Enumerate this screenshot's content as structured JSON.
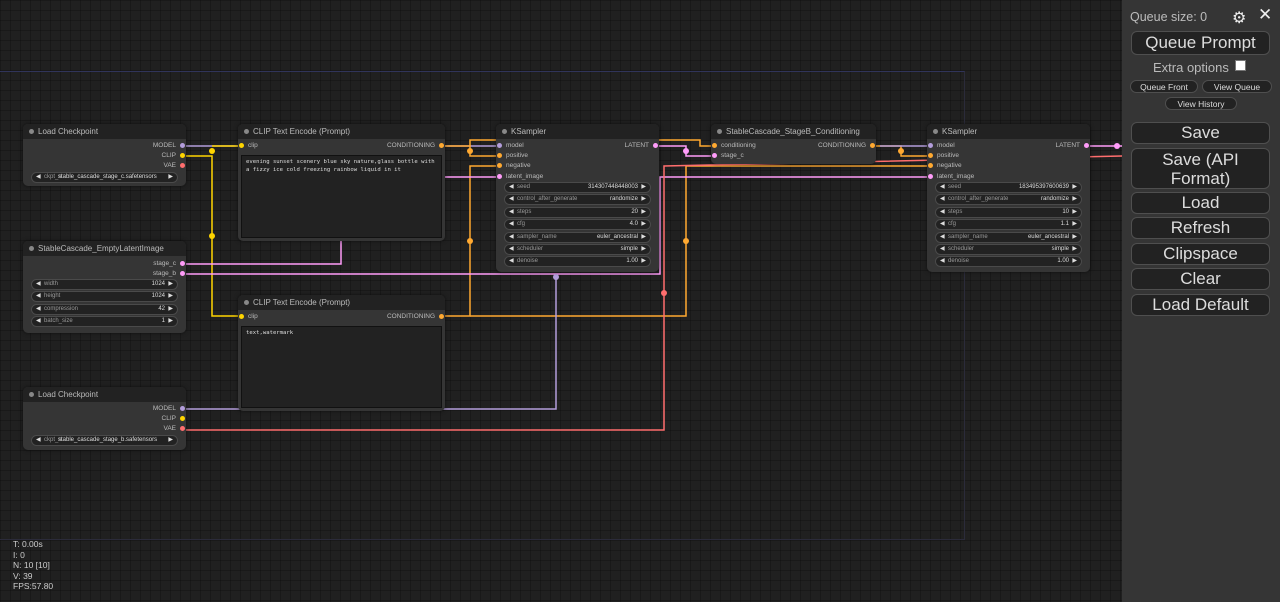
{
  "nodes": {
    "ckpt_c": {
      "title": "Load Checkpoint",
      "outputs": [
        "MODEL",
        "CLIP",
        "VAE"
      ],
      "widget_label": "ckpt_n",
      "widget_value": "stable_cascade_stage_c.safetensors"
    },
    "clip_pos": {
      "title": "CLIP Text Encode (Prompt)",
      "input": "clip",
      "output": "CONDITIONING",
      "text": "evening sunset scenery blue sky nature,glass bottle with a fizzy ice cold freezing rainbow liquid in it"
    },
    "ksampler_c": {
      "title": "KSampler",
      "inputs": [
        "model",
        "positive",
        "negative",
        "latent_image"
      ],
      "output": "LATENT",
      "widgets": [
        {
          "label": "seed",
          "value": "314307448448003"
        },
        {
          "label": "control_after_generate",
          "value": "randomize"
        },
        {
          "label": "steps",
          "value": "20"
        },
        {
          "label": "cfg",
          "value": "4.0"
        },
        {
          "label": "sampler_name",
          "value": "euler_ancestral"
        },
        {
          "label": "scheduler",
          "value": "simple"
        },
        {
          "label": "denoise",
          "value": "1.00"
        }
      ]
    },
    "stageb_cond": {
      "title": "StableCascade_StageB_Conditioning",
      "inputs": [
        "conditioning",
        "stage_c"
      ],
      "output": "CONDITIONING"
    },
    "ksampler_b": {
      "title": "KSampler",
      "inputs": [
        "model",
        "positive",
        "negative",
        "latent_image"
      ],
      "output": "LATENT",
      "widgets": [
        {
          "label": "seed",
          "value": "183495397600639"
        },
        {
          "label": "control_after_generate",
          "value": "randomize"
        },
        {
          "label": "steps",
          "value": "10"
        },
        {
          "label": "cfg",
          "value": "1.1"
        },
        {
          "label": "sampler_name",
          "value": "euler_ancestral"
        },
        {
          "label": "scheduler",
          "value": "simple"
        },
        {
          "label": "denoise",
          "value": "1.00"
        }
      ]
    },
    "empty_latent": {
      "title": "StableCascade_EmptyLatentImage",
      "outputs": [
        "stage_c",
        "stage_b"
      ],
      "widgets": [
        {
          "label": "width",
          "value": "1024"
        },
        {
          "label": "height",
          "value": "1024"
        },
        {
          "label": "compression",
          "value": "42"
        },
        {
          "label": "batch_size",
          "value": "1"
        }
      ]
    },
    "clip_neg": {
      "title": "CLIP Text Encode (Prompt)",
      "input": "clip",
      "output": "CONDITIONING",
      "text": "text,watermark"
    },
    "ckpt_b": {
      "title": "Load Checkpoint",
      "outputs": [
        "MODEL",
        "CLIP",
        "VAE"
      ],
      "widget_label": "ckpt_n",
      "widget_value": "stable_cascade_stage_b.safetensors"
    }
  },
  "stats": {
    "t": "T: 0.00s",
    "i": "I: 0",
    "n": "N: 10 [10]",
    "v": "V: 39",
    "fps": "FPS:57.80"
  },
  "sidebar": {
    "queue_size": "Queue size: 0",
    "queue_prompt": "Queue Prompt",
    "extra_options": "Extra options",
    "queue_front": "Queue Front",
    "view_queue": "View Queue",
    "view_history": "View History",
    "save": "Save",
    "save_api": "Save (API Format)",
    "load": "Load",
    "refresh": "Refresh",
    "clipspace": "Clipspace",
    "clear": "Clear",
    "load_default": "Load Default"
  },
  "colors": {
    "model": "#b39ddb",
    "clip": "#ffd500",
    "vae": "#ff6e6e",
    "conditioning": "#ffa931",
    "latent": "#ff9cf9"
  }
}
